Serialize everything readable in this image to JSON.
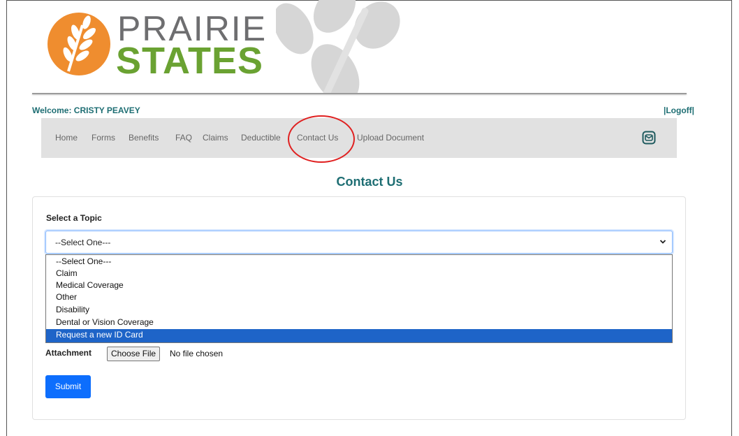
{
  "brand": {
    "line1": "PRAIRIE",
    "line2": "STATES",
    "colors": {
      "orange": "#ef8d2f",
      "green": "#6aa232",
      "gray": "#6e6e70",
      "teal": "#1e6e73"
    }
  },
  "header": {
    "welcome": "Welcome: CRISTY PEAVEY",
    "logoff": "|Logoff|"
  },
  "nav": {
    "items": [
      "Home",
      "Forms",
      "Benefits",
      "FAQ",
      "Claims",
      "Deductible",
      "Contact Us",
      "Upload Document"
    ],
    "highlighted": "Contact Us",
    "mail_icon": "mail-icon"
  },
  "page": {
    "title": "Contact Us"
  },
  "form": {
    "topic_label": "Select a Topic",
    "topic_value": "--Select One---",
    "options": [
      "--Select One---",
      "Claim",
      "Medical Coverage",
      "Other",
      "Disability",
      "Dental or Vision Coverage",
      "Request a new ID Card"
    ],
    "highlighted_option": "Request a new ID Card",
    "attachment_label": "Attachment",
    "choose_file": "Choose File",
    "file_status": "No file chosen",
    "submit": "Submit"
  },
  "colors": {
    "primary": "#0d6efd",
    "selection": "#1e64c8",
    "annotation": "#e02020"
  }
}
